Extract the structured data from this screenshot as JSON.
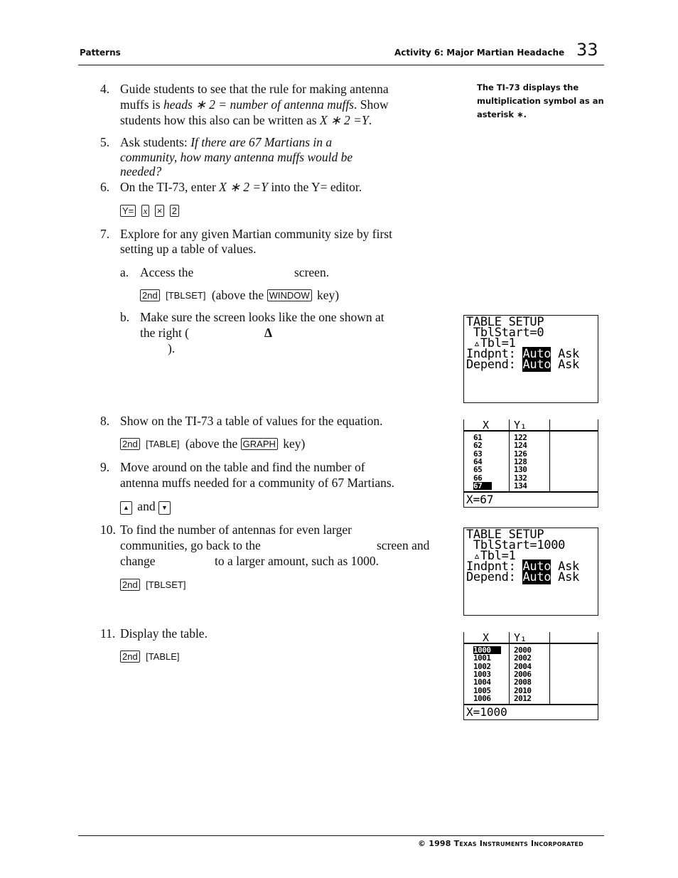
{
  "header": {
    "section": "Patterns",
    "activity": "Activity 6: Major Martian Headache",
    "page_number": "33"
  },
  "sidebar_note": "The TI-73 displays the multiplication symbol as an asterisk ∗.",
  "steps": {
    "s4": {
      "num": "4.",
      "l1": "Guide students to see that the rule for making antenna",
      "l2a": "muffs is ",
      "l2b": "heads ∗ 2 = number of antenna muffs",
      "l2c": ". Show",
      "l3a": "students how this also can be written as ",
      "l3b": "X ∗ 2 =Y",
      "l3c": "."
    },
    "s5": {
      "num": "5.",
      "l1a": "Ask students:  ",
      "l1b": "If there are 67 Martians in a",
      "l2": "community, how many antenna muffs would be",
      "l3": "needed?"
    },
    "s6": {
      "num": "6.",
      "l1a": "On the TI-73, enter ",
      "l1b": "X ∗ 2 =Y",
      "l1c": " into the Y= editor.",
      "keys": [
        "Y=",
        "x",
        "×",
        "2"
      ]
    },
    "s7": {
      "num": "7.",
      "l1": "Explore for any given Martian community size by first",
      "l2": "setting up a table of values.",
      "a": {
        "label": "a.",
        "text_before": "Access the",
        "text_after": "screen.",
        "key1": "2nd",
        "key2": "TBLSET",
        "mid": "(above the",
        "key3": "WINDOW",
        "end": "key)"
      },
      "b": {
        "label": "b.",
        "l1": "Make sure the screen looks like the one shown at",
        "l2a": "the right (",
        "delta": "Δ",
        "l3": ")."
      }
    },
    "s8": {
      "num": "8.",
      "l1": "Show on the TI-73 a table of values for the equation.",
      "key1": "2nd",
      "key2": "TABLE",
      "mid": "(above the",
      "key3": "GRAPH",
      "end": "key)"
    },
    "s9": {
      "num": "9.",
      "l1": "Move around on the table and find the number of",
      "l2": "antenna muffs needed for a community of 67 Martians.",
      "up": "▲",
      "and": "and",
      "down": "▼"
    },
    "s10": {
      "num": "10.",
      "l1": "To find the number of antennas for even larger",
      "l2a": "communities, go back to the",
      "l2b": "screen and",
      "l3a": "change",
      "l3b": "to a larger amount, such as 1000.",
      "key1": "2nd",
      "key2": "TBLSET"
    },
    "s11": {
      "num": "11.",
      "l1": "Display the table.",
      "key1": "2nd",
      "key2": "TABLE"
    }
  },
  "screens": {
    "setup1": {
      "title": "TABLE SETUP",
      "tblstart": " TblStart=0",
      "dtbl": " ▵Tbl=1",
      "indpnt_label": "Indpnt: ",
      "depend_label": "Depend: ",
      "auto": "Auto",
      "ask": " Ask"
    },
    "table1": {
      "col_x": "X",
      "col_y": "Y₁",
      "x": [
        "61",
        "62",
        "63",
        "64",
        "65",
        "66",
        "67"
      ],
      "y": [
        "122",
        "124",
        "126",
        "128",
        "130",
        "132",
        "134"
      ],
      "selected_row": 6,
      "status": "X=67"
    },
    "setup2": {
      "title": "TABLE SETUP",
      "tblstart": " TblStart=1000",
      "dtbl": " ▵Tbl=1",
      "indpnt_label": "Indpnt: ",
      "depend_label": "Depend: ",
      "auto": "Auto",
      "ask": " Ask"
    },
    "table2": {
      "col_x": "X",
      "col_y": "Y₁",
      "x": [
        "1000",
        "1001",
        "1002",
        "1003",
        "1004",
        "1005",
        "1006"
      ],
      "y": [
        "2000",
        "2002",
        "2004",
        "2006",
        "2008",
        "2010",
        "2012"
      ],
      "selected_row": 0,
      "status": "X=1000"
    }
  },
  "footer": "© 1998 Texas Instruments Incorporated"
}
